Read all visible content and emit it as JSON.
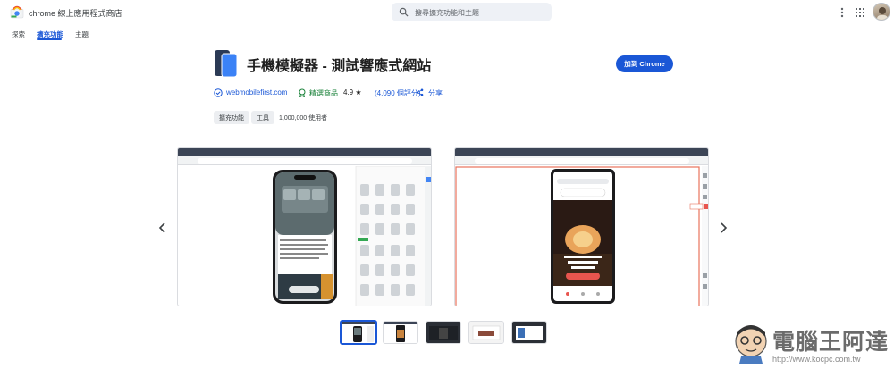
{
  "header": {
    "store_name": "chrome 線上應用程式商店",
    "search_placeholder": "搜尋擴充功能和主題"
  },
  "nav": {
    "tabs": [
      {
        "label": "探索",
        "active": false
      },
      {
        "label": "擴充功能",
        "active": true
      },
      {
        "label": "主題",
        "active": false
      }
    ]
  },
  "extension": {
    "title": "手機模擬器 - 測試響應式網站",
    "add_button": "加到 Chrome",
    "website": "webmobilefirst.com",
    "featured": "精選商品",
    "rating": "4.9 ★",
    "reviews": "(4,090 個評分)",
    "share": "分享",
    "chips": [
      "擴充功能",
      "工具"
    ],
    "users": "1,000,000 使用者"
  },
  "screenshots": {
    "screenshot_1_phone_text": "Reimagined with Liquid Glass, macOS Tahoe is at once fresh and familiar.",
    "screenshot_2_phone_text": "Vous ne savez pas où partir ? Parfait.",
    "screenshot_2_cta": "Je veux Partir !",
    "thumbnail_count": 5,
    "active_thumbnail_index": 0
  },
  "watermark": {
    "title": "電腦王阿達",
    "url": "http://www.kocpc.com.tw"
  },
  "colors": {
    "accent": "#1a57d6",
    "featured_green": "#188038",
    "chip_bg": "#eceef1"
  },
  "icons": [
    "chrome-store-logo",
    "search-icon",
    "more-vert-icon",
    "apps-grid-icon",
    "verified-icon",
    "featured-badge-icon",
    "share-icon",
    "chevron-left-icon",
    "chevron-right-icon"
  ]
}
